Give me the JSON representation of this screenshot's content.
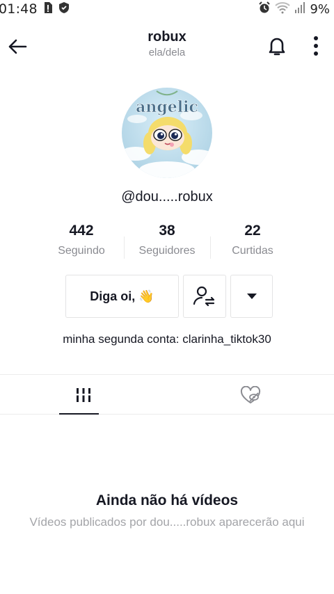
{
  "status_bar": {
    "time": "01:48",
    "battery": "9%",
    "icons": [
      "sim-alert-icon",
      "shield-icon",
      "alarm-icon",
      "wifi-icon",
      "signal-icon"
    ]
  },
  "header": {
    "title": "robux",
    "pronouns": "ela/dela",
    "icons": [
      "back-arrow-icon",
      "bell-icon",
      "more-vertical-icon"
    ]
  },
  "profile": {
    "avatar_text": "angelic",
    "username": "@dou.....robux",
    "bio": "minha segunda conta: clarinha_tiktok30"
  },
  "stats": [
    {
      "value": "442",
      "label": "Seguindo"
    },
    {
      "value": "38",
      "label": "Seguidores"
    },
    {
      "value": "22",
      "label": "Curtidas"
    }
  ],
  "actions": {
    "message_label": "Diga oi, 👋",
    "follow_icon": "user-switch-icon",
    "dropdown_icon": "caret-down-icon"
  },
  "tabs": [
    {
      "name": "videos",
      "icon": "grid-bars-icon",
      "active": true
    },
    {
      "name": "liked",
      "icon": "heart-hidden-icon",
      "active": false
    }
  ],
  "empty_state": {
    "title": "Ainda não há vídeos",
    "description": "Vídeos publicados por dou.....robux aparecerão aqui"
  },
  "colors": {
    "text_primary": "#161823",
    "text_secondary": "#8a8b91",
    "border": "#e3e3e4"
  }
}
